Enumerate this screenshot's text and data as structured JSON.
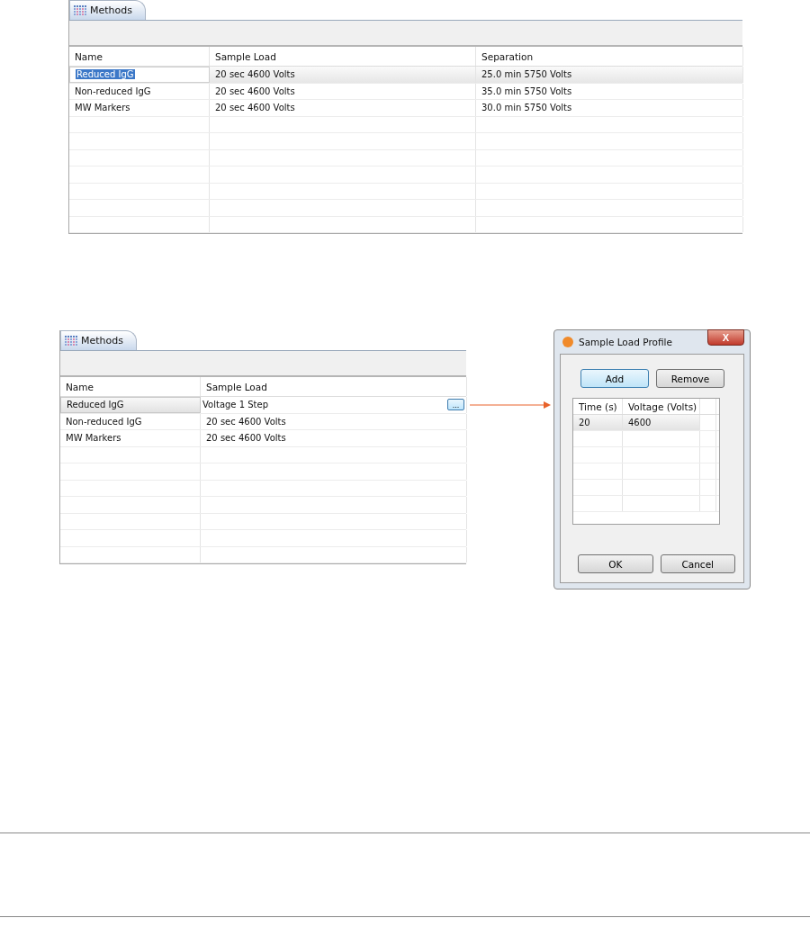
{
  "top_panel": {
    "tab": {
      "label": "Methods",
      "selected": true
    },
    "columns": [
      "Name",
      "Sample Load",
      "Separation"
    ],
    "rows": [
      {
        "cells": [
          "Reduced IgG",
          "20 sec 4600 Volts",
          "25.0 min 5750 Volts"
        ],
        "selected": true
      },
      {
        "cells": [
          "Non-reduced IgG",
          "20 sec 4600 Volts",
          "35.0 min 5750 Volts"
        ],
        "selected": false
      },
      {
        "cells": [
          "MW Markers",
          "20 sec 4600 Volts",
          "30.0 min 5750 Volts"
        ],
        "selected": false
      }
    ]
  },
  "bottom_panel": {
    "tab": {
      "label": "Methods",
      "selected": true
    },
    "columns": [
      "Name",
      "Sample Load"
    ],
    "rows": [
      {
        "cells": [
          "Reduced IgG",
          "Voltage 1 Step"
        ],
        "selected": true,
        "editor_button": "..."
      },
      {
        "cells": [
          "Non-reduced IgG",
          "20 sec 4600 Volts"
        ],
        "selected": false
      },
      {
        "cells": [
          "MW Markers",
          "20 sec 4600 Volts"
        ],
        "selected": false
      }
    ]
  },
  "dialog": {
    "title": "Sample Load Profile",
    "close": "X",
    "buttons_top": [
      "Add",
      "Remove"
    ],
    "columns": [
      "Time (s)",
      "Voltage (Volts)"
    ],
    "rows": [
      {
        "cells": [
          "20",
          "4600"
        ],
        "selected": true
      }
    ],
    "buttons_bottom": [
      "OK",
      "Cancel"
    ]
  }
}
